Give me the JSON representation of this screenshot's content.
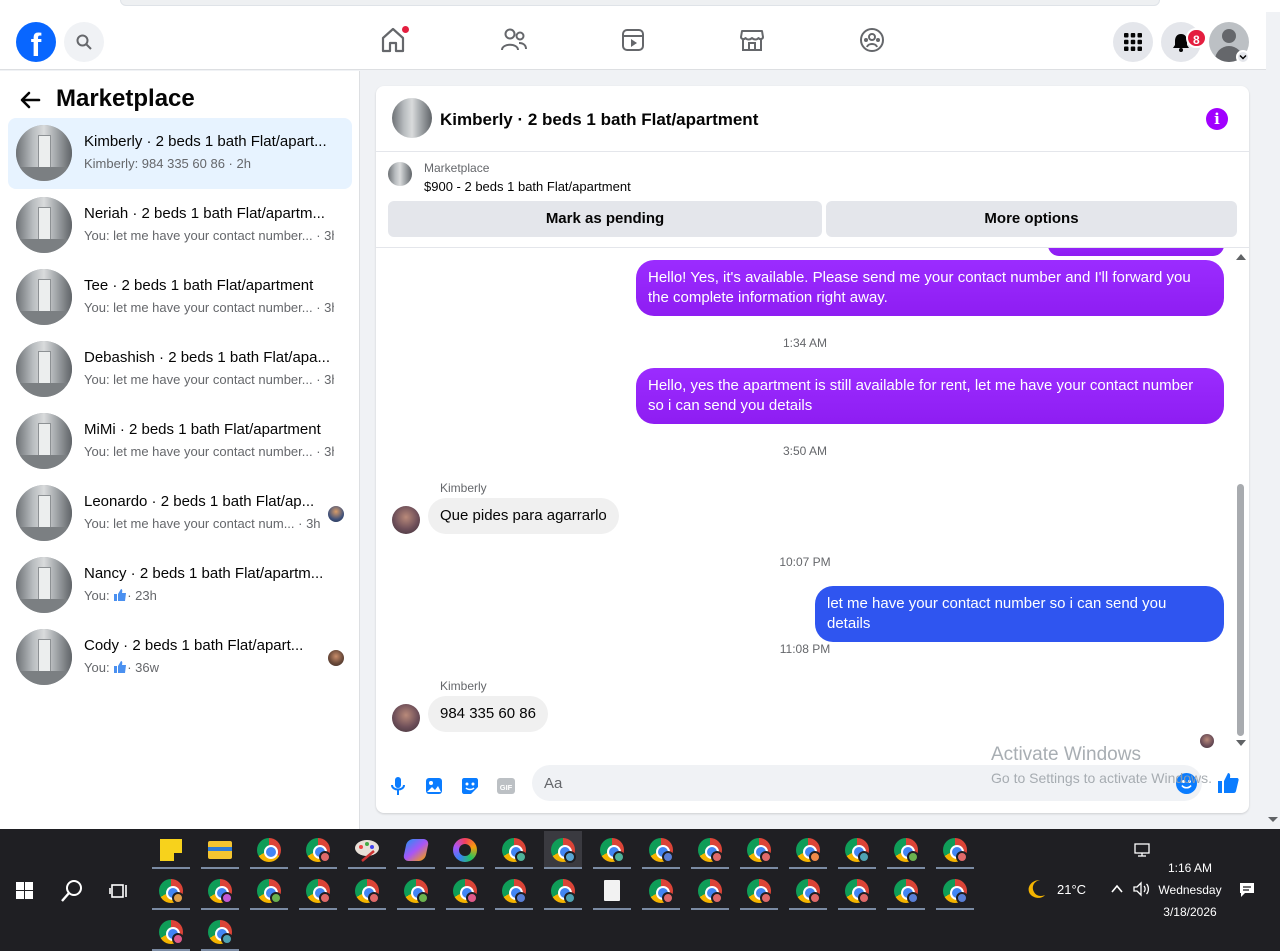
{
  "header": {
    "logo": "f",
    "icons": [
      "search-icon",
      "home-icon",
      "friends-icon",
      "video-icon",
      "marketplace-icon",
      "groups-icon",
      "menu-grid-icon",
      "notifications-icon"
    ],
    "notification_count": "8",
    "accent": "#0866ff"
  },
  "sidebar": {
    "title": "Marketplace",
    "conversations": [
      {
        "name": "Kimberly · 2 beds 1 bath Flat/apart...",
        "preview": "Kimberly: 984 335 60 86 · 2h"
      },
      {
        "name": "Neriah · 2 beds 1 bath Flat/apartm...",
        "preview": "You: let me have your contact number... · 3h"
      },
      {
        "name": "Tee · 2 beds 1 bath Flat/apartment",
        "preview": "You: let me have your contact number... · 3h"
      },
      {
        "name": "Debashish · 2 beds 1 bath Flat/apa...",
        "preview": "You: let me have your contact number... · 3h"
      },
      {
        "name": "MiMi · 2 beds 1 bath Flat/apartment",
        "preview": "You: let me have your contact number... · 3h"
      },
      {
        "name": "Leonardo · 2 beds 1 bath Flat/ap...",
        "preview": "You: let me have your contact num... · 3h"
      },
      {
        "name": "Nancy · 2 beds 1 bath Flat/apartm...",
        "preview_prefix": "You:",
        "preview": "· 23h"
      },
      {
        "name": "Cody · 2 beds 1 bath Flat/apart...",
        "preview_prefix": "You:",
        "preview": "· 36w"
      }
    ]
  },
  "chat": {
    "title": "Kimberly · 2 beds 1 bath Flat/apartment",
    "listing": {
      "source": "Marketplace",
      "price_title": "$900 - 2 beds 1 bath Flat/apartment",
      "mark_pending": "Mark as pending",
      "more_options": "More options"
    },
    "messages": [
      {
        "type": "out",
        "text": "Hello! Yes, it's available. Please send me your contact number and I'll forward you the complete information right away."
      },
      {
        "type": "time",
        "text": "1:34 AM"
      },
      {
        "type": "out",
        "text": "Hello, yes the apartment is still available for rent, let me have your contact number so i can send you details"
      },
      {
        "type": "time",
        "text": "3:50 AM"
      },
      {
        "type": "in",
        "sender": "Kimberly",
        "text": "Que pides para agarrarlo"
      },
      {
        "type": "time",
        "text": "10:07 PM"
      },
      {
        "type": "out",
        "text": "let me have your contact number so i can send you details"
      },
      {
        "type": "time",
        "text": "11:08 PM"
      },
      {
        "type": "in",
        "sender": "Kimberly",
        "text": "984 335 60 86"
      }
    ],
    "composer": {
      "placeholder": "Aa"
    },
    "colors": {
      "outgoing": "#9b2cff",
      "outgoing_latest": "#2f55f0",
      "incoming": "#f0f0f0"
    }
  },
  "watermark": {
    "line1": "Activate Windows",
    "line2": "Go to Settings to activate Windows."
  },
  "taskbar": {
    "weather": "21°C",
    "time": "1:16 AM",
    "day": "Wednesday",
    "date": "3/18/2026"
  }
}
